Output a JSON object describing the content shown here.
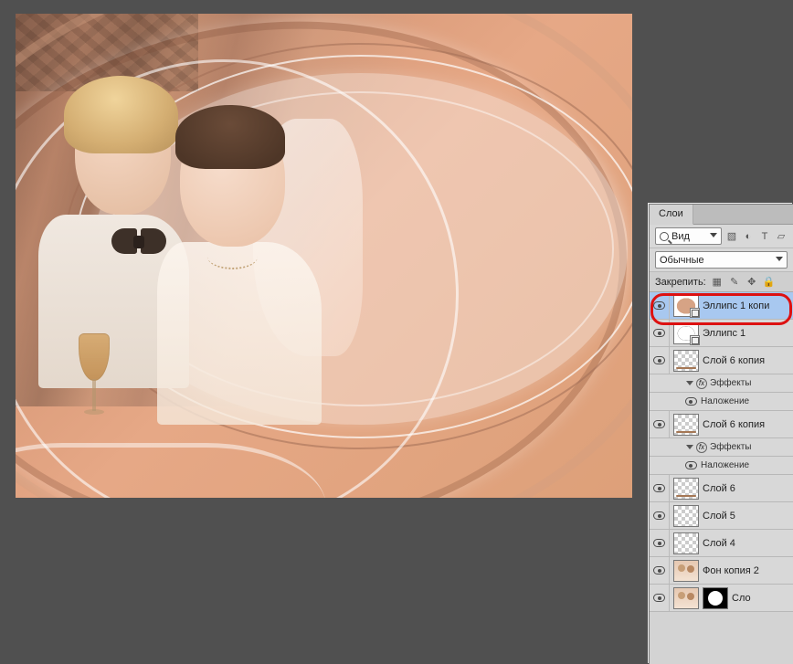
{
  "panel": {
    "tab": "Слои",
    "search_label": "Вид",
    "blend_mode": "Обычные",
    "lock_label": "Закрепить:"
  },
  "layers": [
    {
      "name": "Эллипс 1 копи",
      "selected": true,
      "thumb": "ellipse1",
      "shape": true
    },
    {
      "name": "Эллипс 1",
      "thumb": "ellipse2",
      "shape": true
    },
    {
      "name": "Слой 6 копия",
      "thumb": "checker-line",
      "effects": true
    },
    {
      "name": "Эффекты",
      "sub": 1,
      "icon": "fx"
    },
    {
      "name": "Наложение",
      "sub": 2
    },
    {
      "name": "Слой 6 копия",
      "thumb": "checker-line",
      "effects": true
    },
    {
      "name": "Эффекты",
      "sub": 1,
      "icon": "fx"
    },
    {
      "name": "Наложение",
      "sub": 2
    },
    {
      "name": "Слой 6",
      "thumb": "checker-line"
    },
    {
      "name": "Слой 5",
      "thumb": "checker"
    },
    {
      "name": "Слой 4",
      "thumb": "checker"
    },
    {
      "name": "Фон копия 2",
      "thumb": "people"
    },
    {
      "name": "Сло",
      "thumb": "people",
      "mask": true
    }
  ]
}
